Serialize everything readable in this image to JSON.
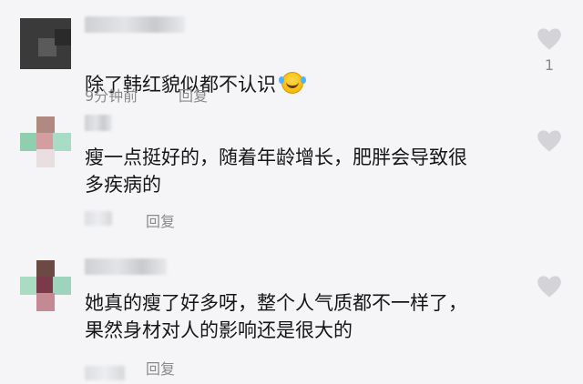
{
  "comments": [
    {
      "text": "除了韩红貌似都不认识",
      "emoji": "laughing-crying-emoji",
      "time": "9分钟前",
      "reply": "回复",
      "like_count": "1"
    },
    {
      "text": "瘦一点挺好的，随着年龄增长，肥胖会导致很\n多疾病的",
      "reply": "回复",
      "like_count": ""
    },
    {
      "text": "她真的瘦了好多呀，整个人气质都不一样了，\n果然身材对人的影响还是很大的",
      "reply": "回复",
      "like_count": ""
    }
  ],
  "colors": {
    "background": "#f5f5f7",
    "text": "#161616",
    "meta": "#8a8a8a",
    "like_icon": "#d4d4d8"
  }
}
